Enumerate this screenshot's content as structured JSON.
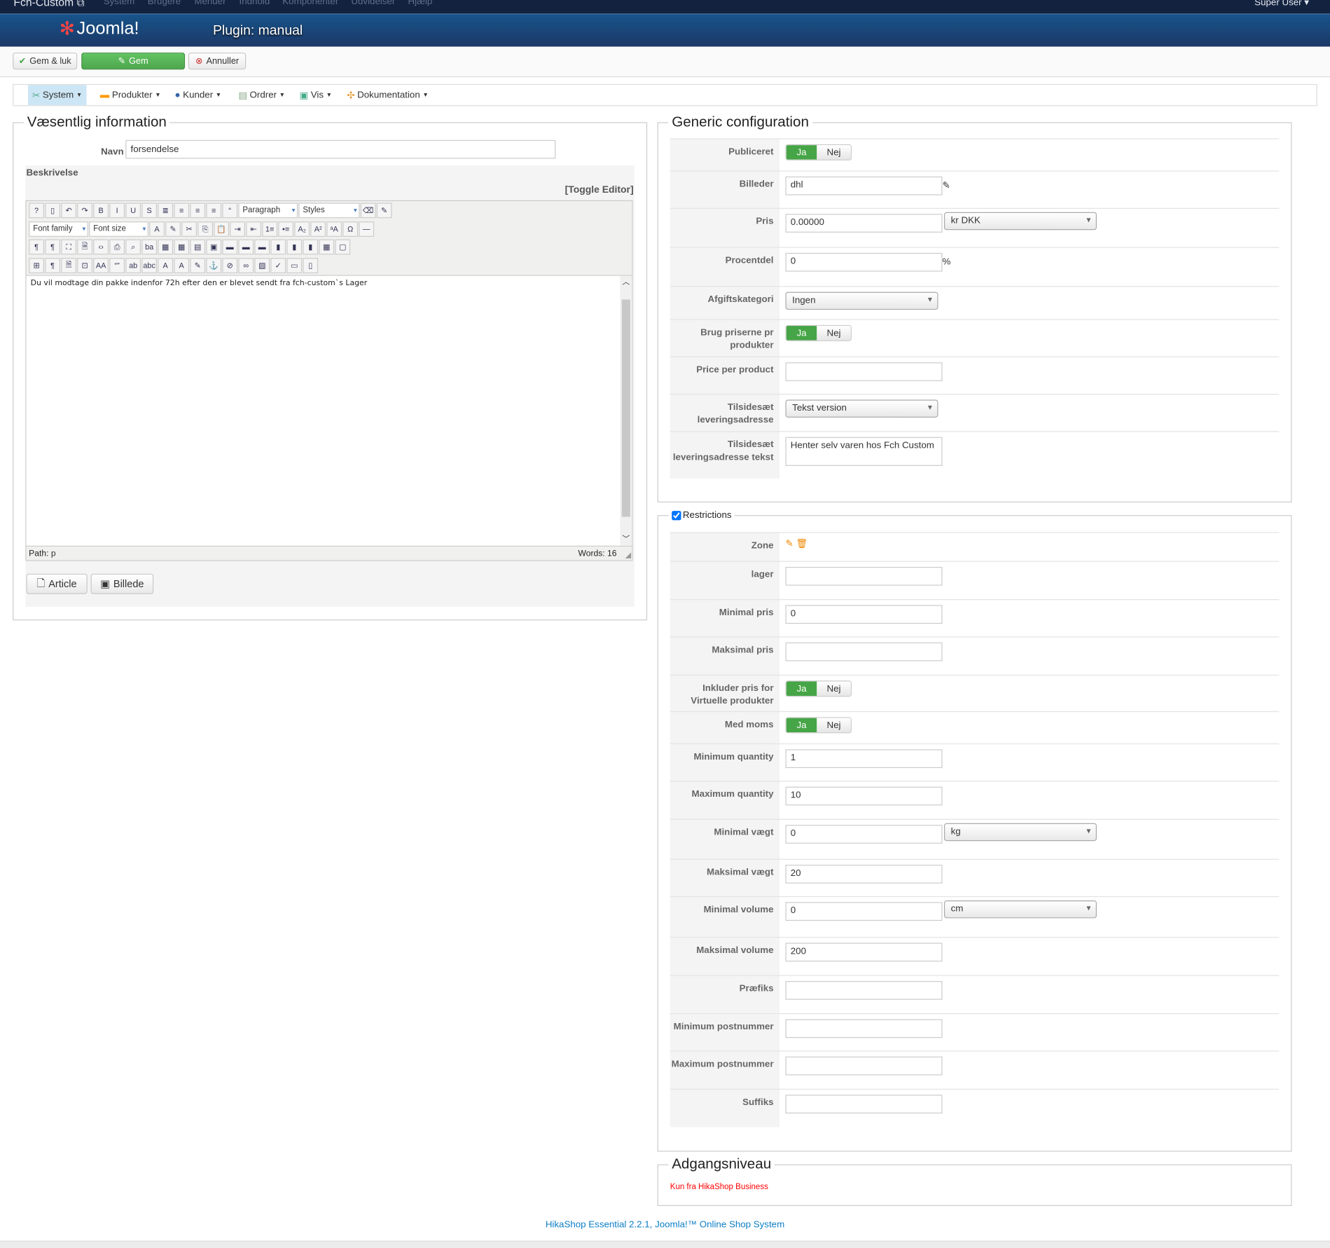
{
  "topbar": {
    "site": "Fch-Custom",
    "menu": [
      "System",
      "Brugere",
      "Menuer",
      "Indhold",
      "Komponenter",
      "Udvidelser",
      "Hjælp"
    ],
    "user": "Super User"
  },
  "header": {
    "logo": "Joomla!",
    "title": "Plugin: manual"
  },
  "toolbar": {
    "save_close": "Gem & luk",
    "save": "Gem",
    "cancel": "Annuller"
  },
  "hikamenu": [
    "System",
    "Produkter",
    "Kunder",
    "Ordrer",
    "Vis",
    "Dokumentation"
  ],
  "left": {
    "legend": "Væsentlig information",
    "name_label": "Navn",
    "name_value": "forsendelse",
    "desc_label": "Beskrivelse",
    "toggle": "[Toggle Editor]",
    "editor": {
      "paragraph": "Paragraph",
      "styles": "Styles",
      "font_family": "Font family",
      "font_size": "Font size",
      "content": "Du vil modtage din pakke indenfor 72h efter den er blevet sendt fra fch-custom`s Lager",
      "path_label": "Path:",
      "path_value": "p",
      "words": "Words: 16"
    },
    "article_btn": "Article",
    "image_btn": "Billede"
  },
  "generic": {
    "legend": "Generic configuration",
    "rows": [
      {
        "label": "Publiceret",
        "type": "toggle",
        "on": "Ja",
        "off": "Nej"
      },
      {
        "label": "Billeder",
        "type": "input",
        "value": "dhl",
        "icon": "edit-icon"
      },
      {
        "label": "Pris",
        "type": "input-select",
        "value": "0.00000",
        "select": "kr DKK"
      },
      {
        "label": "Procentdel",
        "type": "input",
        "value": "0",
        "suffix": "%"
      },
      {
        "label": "Afgiftskategori",
        "type": "select",
        "value": "Ingen"
      },
      {
        "label": "Brug priserne pr produkter",
        "type": "toggle",
        "on": "Ja",
        "off": "Nej"
      },
      {
        "label": "Price per product",
        "type": "input",
        "value": ""
      },
      {
        "label": "Tilsidesæt leveringsadresse",
        "type": "select",
        "value": "Tekst version"
      },
      {
        "label": "Tilsidesæt leveringsadresse tekst",
        "type": "textarea",
        "value": "Henter selv varen hos Fch Custom"
      }
    ]
  },
  "restrictions": {
    "legend": "Restrictions",
    "checked": true,
    "rows": [
      {
        "label": "Zone",
        "type": "icons"
      },
      {
        "label": "lager",
        "type": "input",
        "value": ""
      },
      {
        "label": "Minimal pris",
        "type": "input",
        "value": "0"
      },
      {
        "label": "Maksimal pris",
        "type": "input",
        "value": ""
      },
      {
        "label": "Inkluder pris for Virtuelle produkter",
        "type": "toggle",
        "on": "Ja",
        "off": "Nej"
      },
      {
        "label": "Med moms",
        "type": "toggle",
        "on": "Ja",
        "off": "Nej"
      },
      {
        "label": "Minimum quantity",
        "type": "input",
        "value": "1"
      },
      {
        "label": "Maximum quantity",
        "type": "input",
        "value": "10"
      },
      {
        "label": "Minimal vægt",
        "type": "input-select",
        "value": "0",
        "select": "kg"
      },
      {
        "label": "Maksimal vægt",
        "type": "input",
        "value": "20"
      },
      {
        "label": "Minimal volume",
        "type": "input-select",
        "value": "0",
        "select": "cm"
      },
      {
        "label": "Maksimal volume",
        "type": "input",
        "value": "200"
      },
      {
        "label": "Præfiks",
        "type": "input",
        "value": ""
      },
      {
        "label": "Minimum postnummer",
        "type": "input",
        "value": ""
      },
      {
        "label": "Maximum postnummer",
        "type": "input",
        "value": ""
      },
      {
        "label": "Suffiks",
        "type": "input",
        "value": ""
      }
    ]
  },
  "access": {
    "legend": "Adgangsniveau",
    "note": "Kun fra HikaShop Business"
  },
  "footer": "HikaShop Essential 2.2.1, Joomla!™ Online Shop System",
  "colors": {
    "accent": "#46a546",
    "header": "#17548a",
    "link": "#0c7ec6",
    "note": "#ff0000"
  }
}
